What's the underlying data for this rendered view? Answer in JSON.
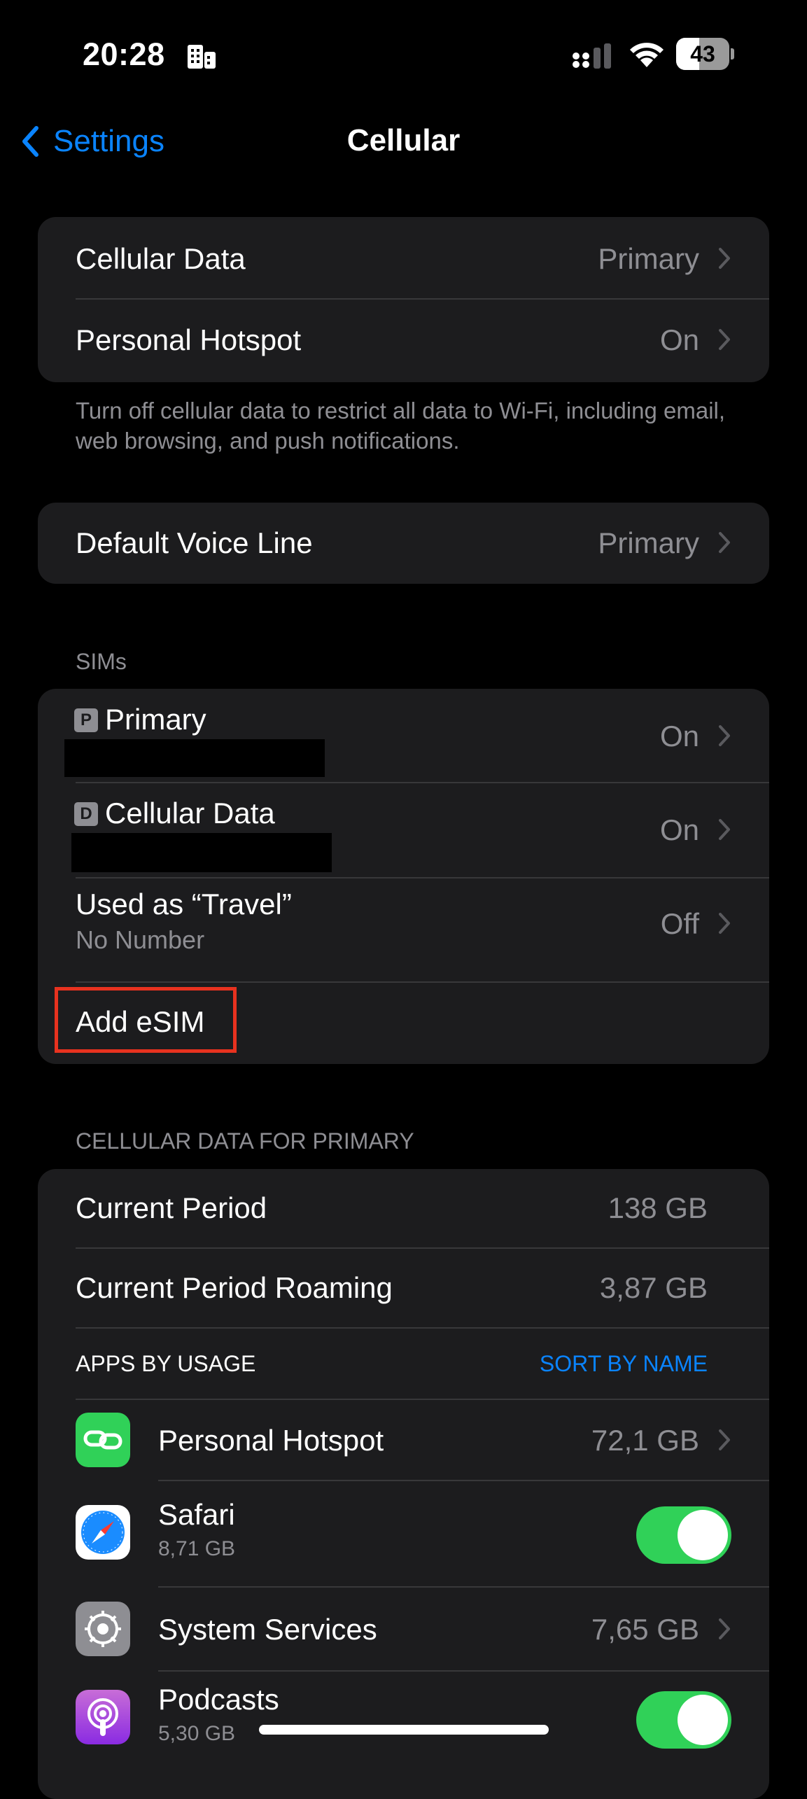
{
  "status_bar": {
    "time": "20:28",
    "battery": "43",
    "battery_level": 0.43
  },
  "nav": {
    "back_label": "Settings",
    "title": "Cellular"
  },
  "group1": {
    "rows": [
      {
        "label": "Cellular Data",
        "value": "Primary"
      },
      {
        "label": "Personal Hotspot",
        "value": "On"
      }
    ],
    "footer": "Turn off cellular data to restrict all data to Wi-Fi, including email, web browsing, and push notifications."
  },
  "group2": {
    "rows": [
      {
        "label": "Default Voice Line",
        "value": "Primary"
      }
    ]
  },
  "sims": {
    "header": "SIMs",
    "rows": [
      {
        "badge": "P",
        "label": "Primary",
        "value": "On"
      },
      {
        "badge": "D",
        "label": "Cellular Data",
        "value": "On"
      },
      {
        "label": "Used as “Travel”",
        "sub": "No Number",
        "value": "Off"
      }
    ],
    "add_esim": "Add eSIM"
  },
  "usage": {
    "header": "CELLULAR DATA FOR PRIMARY",
    "current_period": {
      "label": "Current Period",
      "value": "138 GB"
    },
    "roaming": {
      "label": "Current Period Roaming",
      "value": "3,87 GB"
    },
    "apps_header": "APPS BY USAGE",
    "sort_label": "SORT BY NAME",
    "apps": [
      {
        "name": "Personal Hotspot",
        "value": "72,1 GB",
        "icon": "hotspot-icon"
      },
      {
        "name": "Safari",
        "sub": "8,71 GB",
        "icon": "safari-icon",
        "enabled": true
      },
      {
        "name": "System Services",
        "value": "7,65 GB",
        "icon": "gear-icon"
      },
      {
        "name": "Podcasts",
        "sub": "5,30 GB",
        "icon": "podcasts-icon",
        "enabled": true
      }
    ]
  },
  "colors": {
    "accent": "#0a84ff",
    "toggle_on": "#30d158",
    "highlight": "#e8321f",
    "cell": "#1c1c1e"
  }
}
